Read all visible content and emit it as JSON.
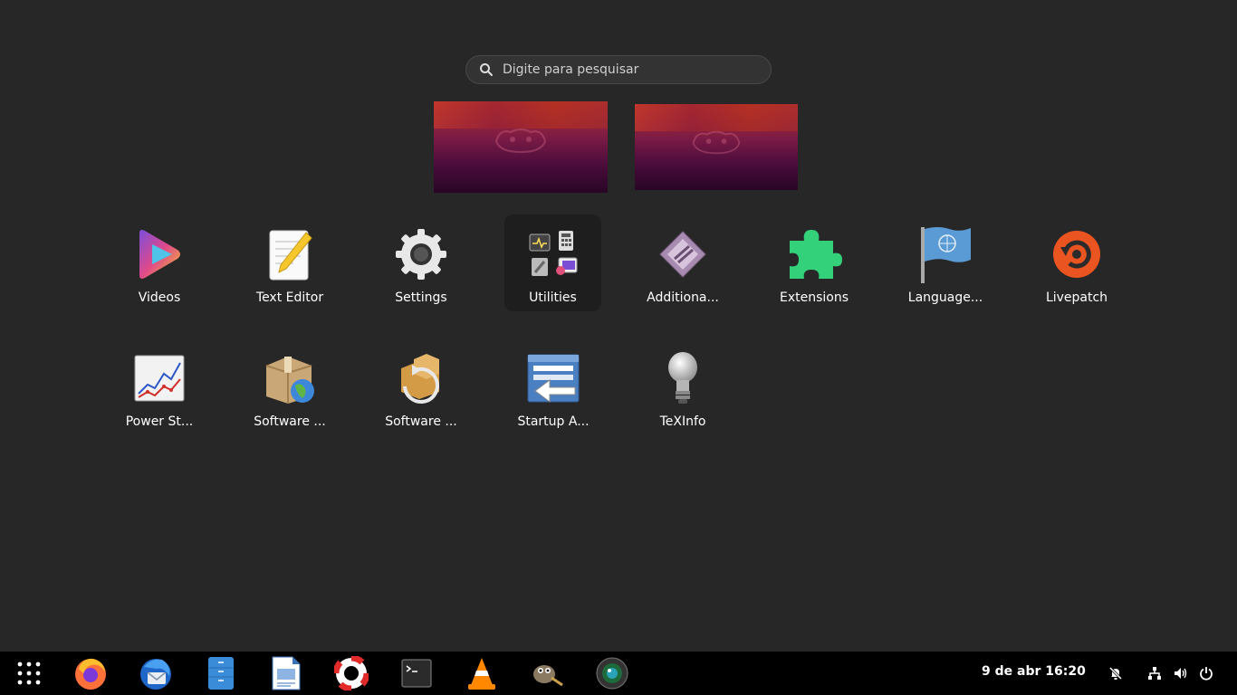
{
  "search": {
    "placeholder": "Digite para pesquisar",
    "value": ""
  },
  "apps_row1": [
    {
      "label": "Videos",
      "icon": "videos-icon"
    },
    {
      "label": "Text Editor",
      "icon": "text-editor-icon"
    },
    {
      "label": "Settings",
      "icon": "gear-icon"
    },
    {
      "label": "Utilities",
      "icon": "utilities-folder-icon"
    },
    {
      "label": "Additiona...",
      "icon": "additional-drivers-icon"
    },
    {
      "label": "Extensions",
      "icon": "puzzle-icon"
    },
    {
      "label": "Language...",
      "icon": "flag-icon"
    },
    {
      "label": "Livepatch",
      "icon": "livepatch-icon"
    }
  ],
  "apps_row2": [
    {
      "label": "Power St...",
      "icon": "power-statistics-icon"
    },
    {
      "label": "Software ...",
      "icon": "software-package-icon"
    },
    {
      "label": "Software ...",
      "icon": "software-updater-icon"
    },
    {
      "label": "Startup A...",
      "icon": "startup-apps-icon"
    },
    {
      "label": "TeXInfo",
      "icon": "lightbulb-icon"
    }
  ],
  "dock": {
    "items": [
      "app-grid-icon",
      "firefox-icon",
      "thunderbird-icon",
      "files-icon",
      "writer-icon",
      "help-icon",
      "terminal-icon",
      "vlc-icon",
      "gimp-icon",
      "camera-icon"
    ]
  },
  "clock": "9 de abr  16:20",
  "colors": {
    "background": "#272727",
    "dock": "#000000",
    "folder_bg": "#1e1e1e"
  }
}
